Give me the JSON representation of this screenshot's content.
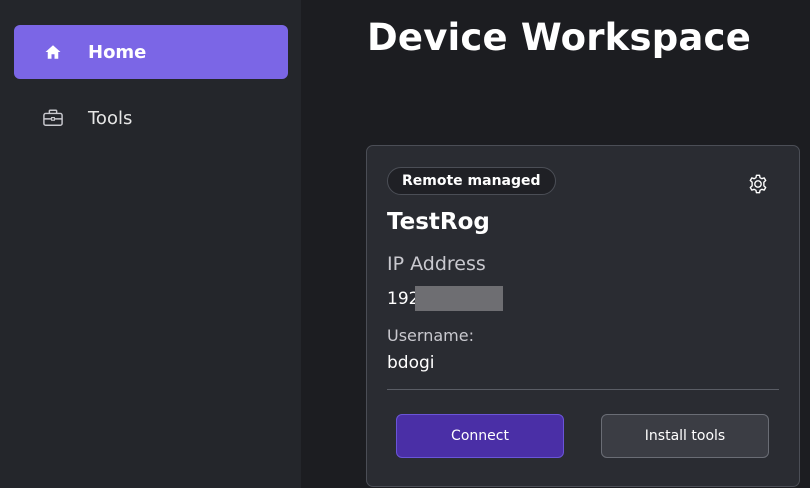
{
  "sidebar": {
    "items": [
      {
        "label": "Home",
        "icon": "home-icon",
        "active": true
      },
      {
        "label": "Tools",
        "icon": "toolbox-icon",
        "active": false
      }
    ]
  },
  "page": {
    "title": "Device Workspace"
  },
  "device_card": {
    "badge": "Remote managed",
    "name": "TestRog",
    "ip_label": "IP Address",
    "ip_value_visible": "192",
    "username_label": "Username:",
    "username_value": "bdogi",
    "connect_label": "Connect",
    "install_label": "Install tools"
  },
  "colors": {
    "accent": "#7b66e6",
    "primary_button": "#4a2fa6",
    "sidebar_bg": "#24262b",
    "main_bg": "#1c1d21",
    "card_bg": "#2a2c32"
  }
}
